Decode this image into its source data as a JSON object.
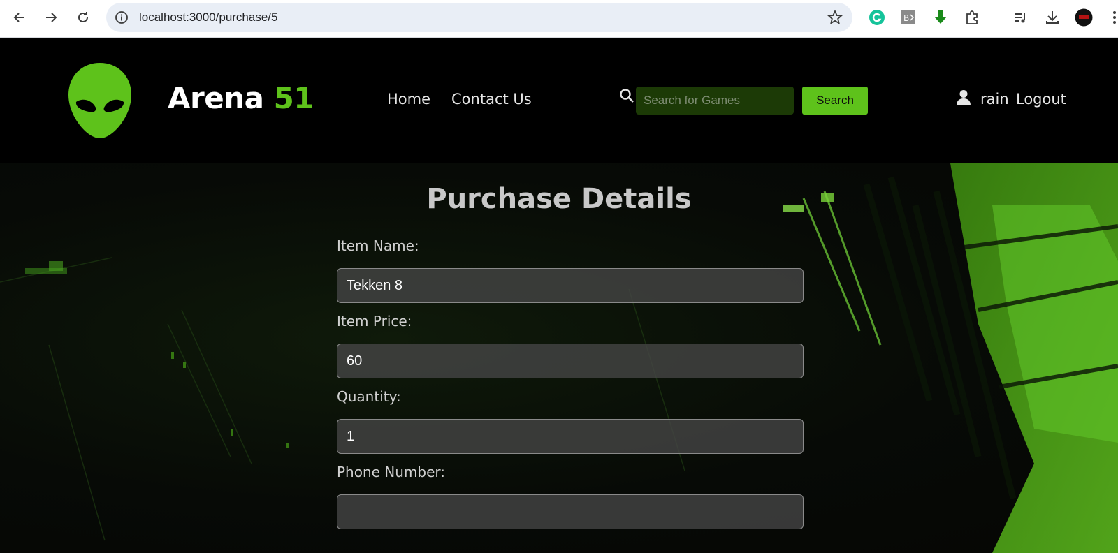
{
  "browser": {
    "url": "localhost:3000/purchase/5"
  },
  "header": {
    "brand_main": "Arena ",
    "brand_accent": "51",
    "nav": [
      {
        "label": "Home"
      },
      {
        "label": "Contact Us"
      }
    ],
    "search_placeholder": "Search for Games",
    "search_button": "Search",
    "username": "rain",
    "logout_label": "Logout"
  },
  "page": {
    "title": "Purchase Details",
    "fields": [
      {
        "label": "Item Name:",
        "value": "Tekken 8"
      },
      {
        "label": "Item Price:",
        "value": "60"
      },
      {
        "label": "Quantity:",
        "value": "1"
      },
      {
        "label": "Phone Number:",
        "value": ""
      }
    ]
  },
  "colors": {
    "accent": "#5ec21b",
    "header_bg": "#000000",
    "search_bg": "#1c3a06"
  }
}
